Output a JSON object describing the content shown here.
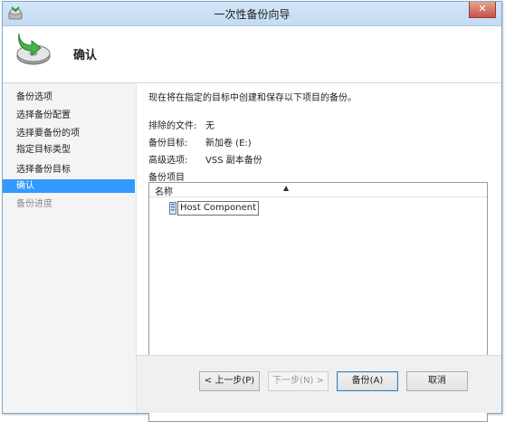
{
  "window": {
    "title": "一次性备份向导",
    "close_glyph": "✕"
  },
  "header": {
    "title": "确认"
  },
  "nav": {
    "items": [
      {
        "label": "备份选项"
      },
      {
        "label": "选择备份配置"
      },
      {
        "label": "选择要备份的项"
      },
      {
        "label": "指定目标类型"
      },
      {
        "label": "选择备份目标"
      },
      {
        "label": "确认",
        "selected": true
      },
      {
        "label": "备份进度",
        "disabled": true
      }
    ]
  },
  "content": {
    "intro": "现在将在指定的目标中创建和保存以下项目的备份。",
    "properties": [
      {
        "label": "排除的文件:",
        "value": "无"
      },
      {
        "label": "备份目标:",
        "value": "新加卷 (E:)"
      },
      {
        "label": "高级选项:",
        "value": "VSS 副本备份"
      }
    ],
    "items_label": "备份项目",
    "listview": {
      "column_name": "名称",
      "sort_arrow": "▲",
      "rows": [
        {
          "name": "Host Component"
        }
      ]
    }
  },
  "buttons": {
    "back": "< 上一步(P)",
    "next": "下一步(N) >",
    "backup": "备份(A)",
    "cancel": "取消"
  },
  "colors": {
    "selection": "#3399ff",
    "titlebar": "#c9dff5"
  }
}
